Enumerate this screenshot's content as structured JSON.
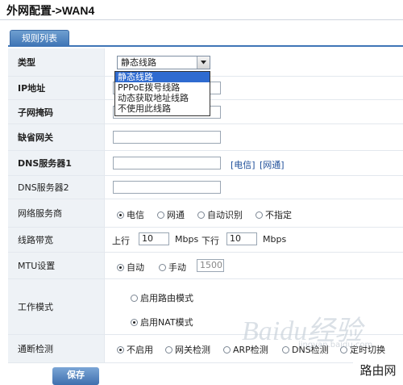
{
  "title": "外网配置->WAN4",
  "tab": {
    "label": "规则列表"
  },
  "type": {
    "label": "类型",
    "selected": "静态线路",
    "options": [
      "静态线路",
      "PPPoE拨号线路",
      "动态获取地址线路",
      "不使用此线路"
    ]
  },
  "ip": {
    "label": "IP地址",
    "value": ""
  },
  "mask": {
    "label": "子网掩码",
    "value": ""
  },
  "gateway": {
    "label": "缺省网关",
    "value": ""
  },
  "dns1": {
    "label": "DNS服务器1",
    "value": "",
    "link1": "[电信]",
    "link2": "[网通]"
  },
  "dns2": {
    "label": "DNS服务器2",
    "value": ""
  },
  "isp": {
    "label": "网络服务商",
    "options": [
      "电信",
      "网通",
      "自动识别",
      "不指定"
    ],
    "selected_index": 0
  },
  "bandwidth": {
    "label": "线路带宽",
    "up_label": "上行",
    "up_value": "10",
    "unit": "Mbps",
    "down_label": "下行",
    "down_value": "10",
    "unit2": "Mbps"
  },
  "mtu": {
    "label": "MTU设置",
    "auto": "自动",
    "manual": "手动",
    "value": "1500",
    "selected": "auto"
  },
  "mode": {
    "label": "工作模式",
    "routing": "启用路由模式",
    "nat": "启用NAT模式",
    "selected": "nat"
  },
  "detect": {
    "label": "通断检测",
    "options": [
      "不启用",
      "网关检测",
      "ARP检测",
      "DNS检测",
      "定时切换"
    ],
    "selected_index": 0
  },
  "save_label": "保存",
  "watermark": {
    "main": "Baidu经验",
    "sub": "jingyan.baidu.com"
  },
  "corner_brand": "路由网",
  "colors": {
    "accent": "#3f75b6",
    "label_bg": "#eef2f6",
    "select_highlight": "#2f6bd0"
  }
}
